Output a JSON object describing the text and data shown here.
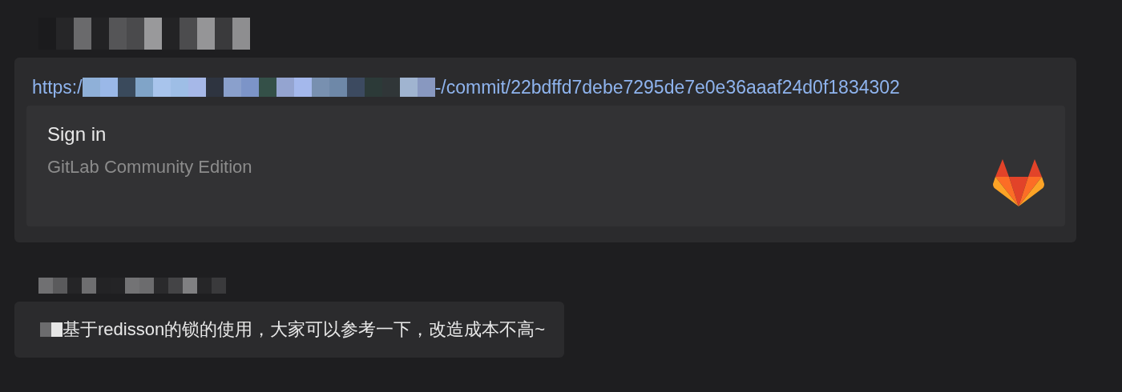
{
  "messages": [
    {
      "kind": "link_card",
      "url_start": "https:/",
      "url_end": "-/commit/22bdffd7debe7295de7e0e36aaaf24d0f1834302",
      "preview": {
        "title": "Sign in",
        "site": "GitLab Community Edition"
      }
    },
    {
      "kind": "text",
      "text": "基于redisson的锁的使用，大家可以参考一下，改造成本不高~"
    }
  ]
}
